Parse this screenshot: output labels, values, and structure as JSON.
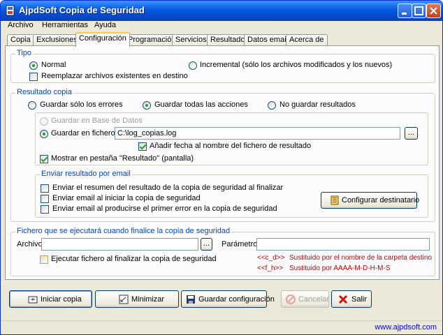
{
  "window": {
    "title": "AjpdSoft Copia de Seguridad"
  },
  "menu": [
    "Archivo",
    "Herramientas",
    "Ayuda"
  ],
  "tabs": [
    "Copia",
    "Exclusiones",
    "Configuración",
    "Programación",
    "Servicios",
    "Resultado",
    "Datos email",
    "Acerca de"
  ],
  "tipo": {
    "legend": "Tipo",
    "normal": "Normal",
    "incremental": "Incremental (sólo los archivos modificados y los nuevos)",
    "replace": "Reemplazar archivos existentes en destino"
  },
  "resultado": {
    "legend": "Resultado copia",
    "errors_only": "Guardar sólo los errores",
    "all_actions": "Guardar todas las acciones",
    "no_save": "No guardar resultados",
    "db": "Guardar en Base de Datos",
    "file": "Guardar en fichero de texto",
    "file_path": "C:\\log_copias.log",
    "browse": "...",
    "add_date": "Añadir fecha al nombre del fichero de resultado",
    "show_tab": "Mostrar en pestaña \"Resultado\" (pantalla)"
  },
  "email": {
    "legend": "Enviar resultado por email",
    "summary": "Enviar el resumen del resultado de la copia de seguridad al finalizar",
    "on_start": "Enviar email al iniciar la copia de seguridad",
    "on_error": "Enviar email al producirse el primer error en la copia de seguridad",
    "config_btn": "Configurar destinatario"
  },
  "fichero": {
    "legend": "Fichero que se ejecutará cuando finalice la copia de seguridad",
    "archivo_label": "Archivo",
    "archivo_value": "",
    "browse": "...",
    "params_label": "Parámetros",
    "params_value": "",
    "run_label": "Ejecutar fichero al finalizar la copia de seguridad",
    "hint1_key": "<<c_d>>",
    "hint1_text": "Sustituido por el nombre de la carpeta destino",
    "hint2_key": "<<f_h>>",
    "hint2_text": "Sustituido por AAAA-M-D-H-M-S"
  },
  "buttons": {
    "start": "Iniciar copia",
    "minimize": "Minimizar",
    "save": "Guardar configuración",
    "cancel": "Cancelar",
    "exit": "Salir"
  },
  "status": {
    "url": "www.ajpdsoft.com"
  },
  "colors": {
    "legend": "#0046d5",
    "hint": "#c00000",
    "title_bar": "#0a5fe3"
  }
}
